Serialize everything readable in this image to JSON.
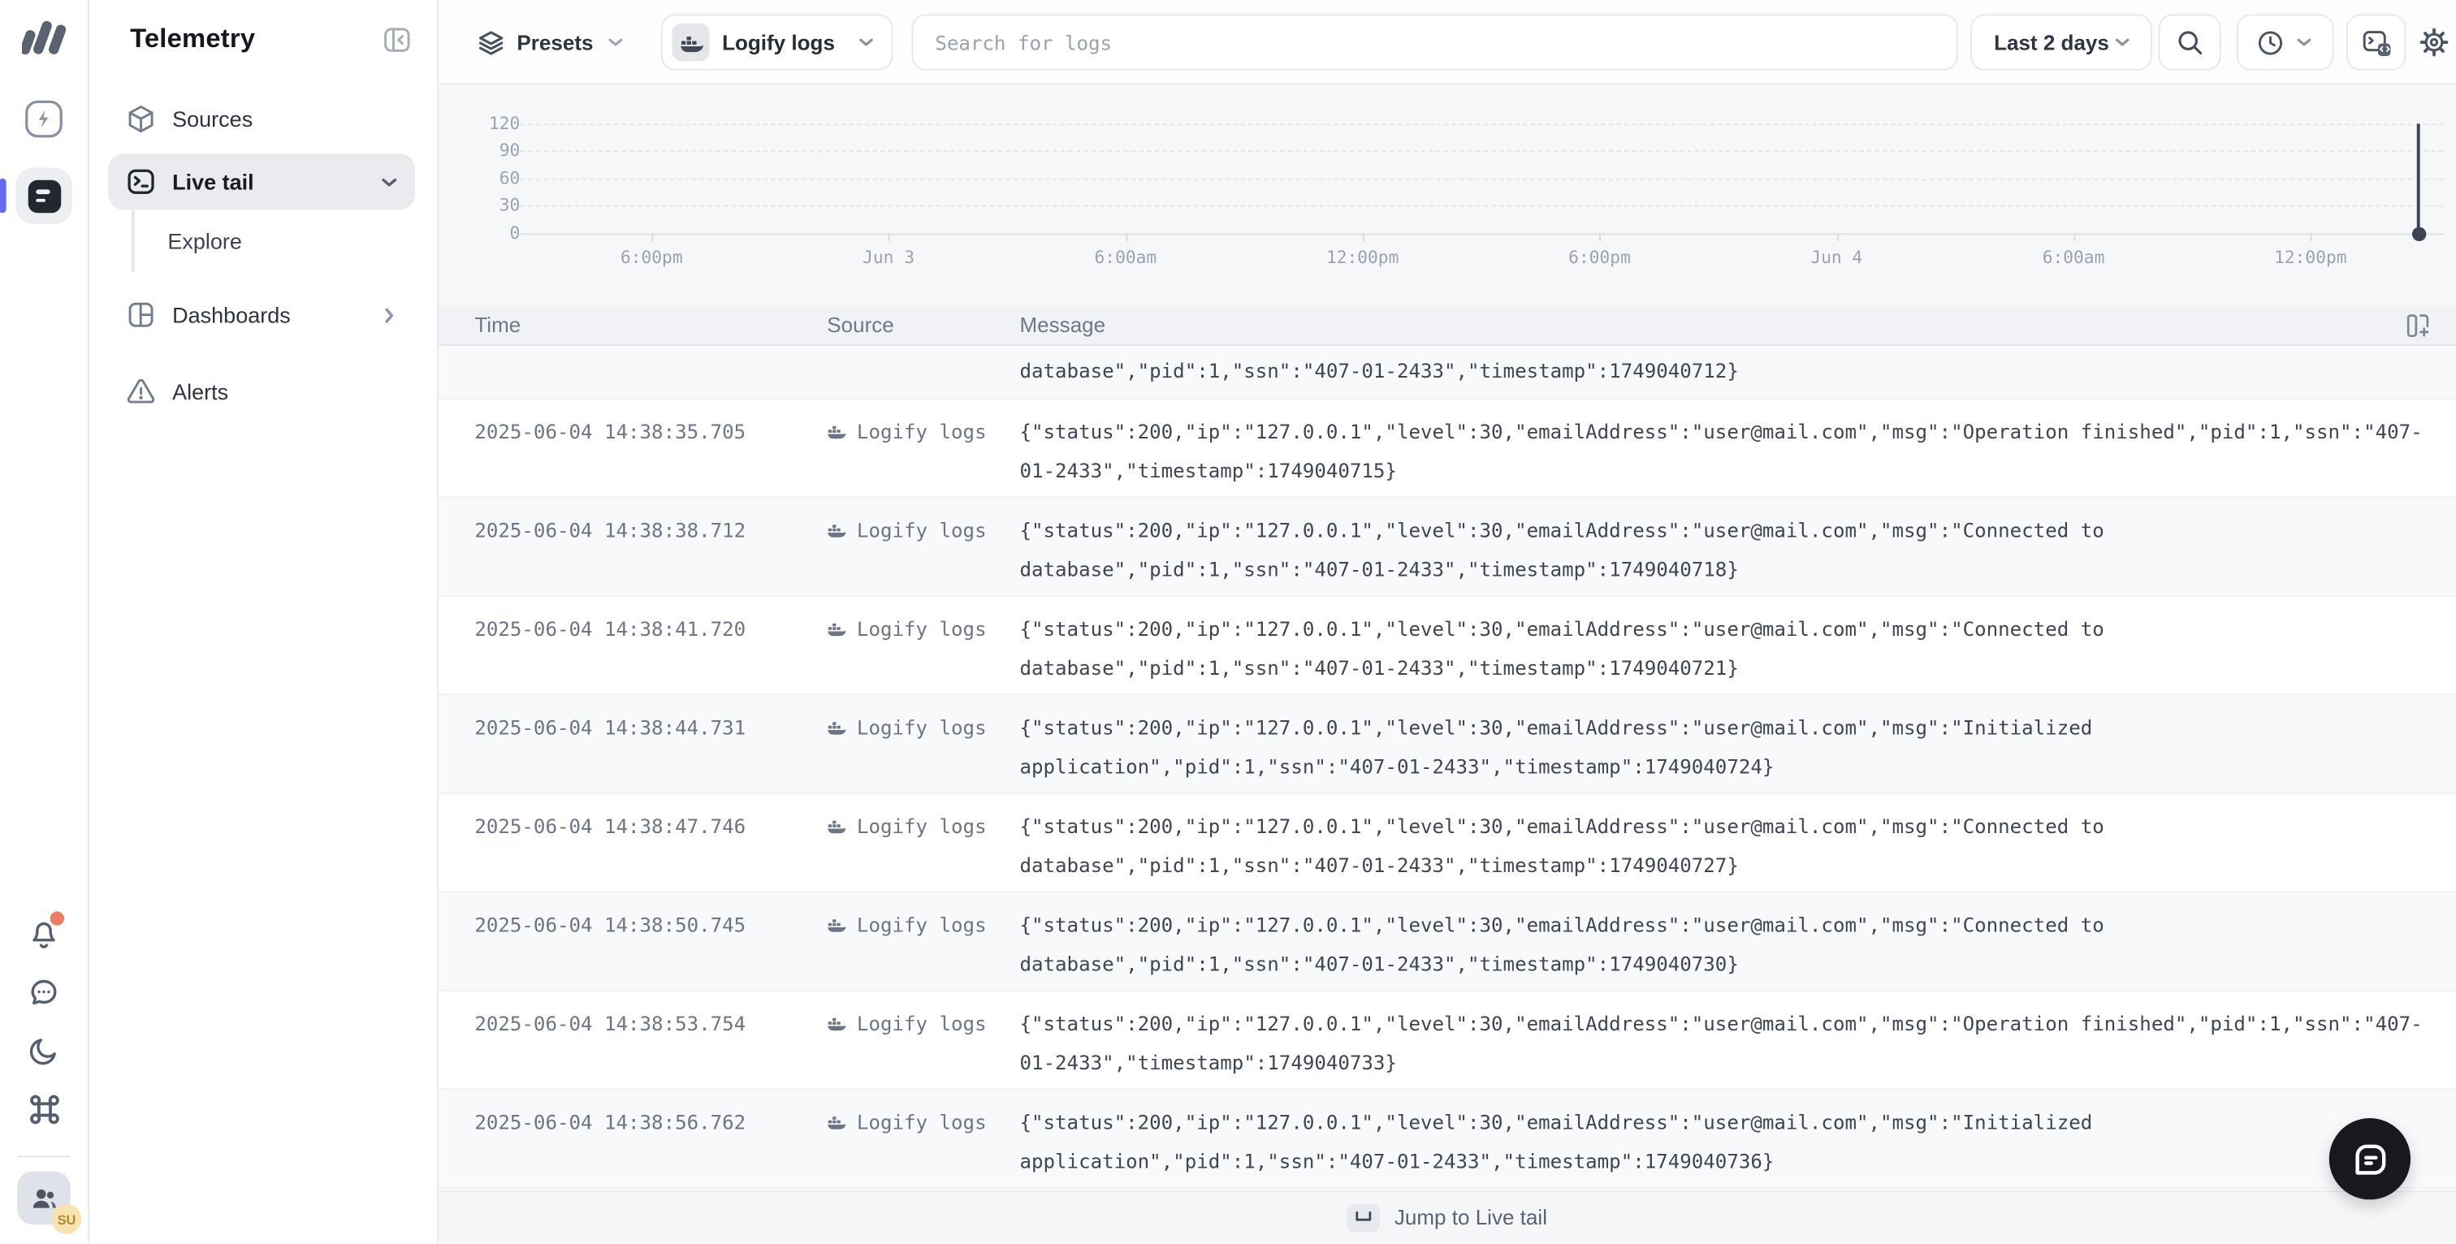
{
  "app": {
    "title": "Telemetry"
  },
  "rail": {
    "user_initials": "SU"
  },
  "sidebar": {
    "title": "Telemetry",
    "items": [
      {
        "label": "Sources"
      },
      {
        "label": "Live tail",
        "selected": true
      },
      {
        "label": "Explore",
        "child": true
      },
      {
        "label": "Dashboards"
      },
      {
        "label": "Alerts"
      }
    ]
  },
  "topbar": {
    "presets_label": "Presets",
    "source_select": "Logify logs",
    "search_placeholder": "Search for logs",
    "time_range": "Last 2 days"
  },
  "chart_data": {
    "type": "bar",
    "title": "",
    "xlabel": "",
    "ylabel": "",
    "x_ticks": [
      "6:00pm",
      "Jun 3",
      "6:00am",
      "12:00pm",
      "6:00pm",
      "Jun 4",
      "6:00am",
      "12:00pm"
    ],
    "y_ticks": [
      "120",
      "90",
      "60",
      "30",
      "0"
    ],
    "ylim": [
      0,
      120
    ],
    "grid": "horizontal-dashed",
    "legend": "none",
    "series": [
      {
        "name": "log volume",
        "values": []
      }
    ],
    "time_cursor_at_right_edge": true
  },
  "table": {
    "columns": [
      "Time",
      "Source",
      "Message"
    ],
    "partial_row": {
      "message_line": "database\",\"pid\":1,\"ssn\":\"407-01-2433\",\"timestamp\":1749040712}"
    },
    "rows": [
      {
        "time": "2025-06-04 14:38:35.705",
        "source": "Logify logs",
        "message_lines": [
          "{\"status\":200,\"ip\":\"127.0.0.1\",\"level\":30,\"emailAddress\":\"user@mail.com\",\"msg\":\"Operation finished\",\"pid\":1,\"ssn\":\"407-",
          "01-2433\",\"timestamp\":1749040715}"
        ]
      },
      {
        "time": "2025-06-04 14:38:38.712",
        "source": "Logify logs",
        "message_lines": [
          "{\"status\":200,\"ip\":\"127.0.0.1\",\"level\":30,\"emailAddress\":\"user@mail.com\",\"msg\":\"Connected to",
          "database\",\"pid\":1,\"ssn\":\"407-01-2433\",\"timestamp\":1749040718}"
        ]
      },
      {
        "time": "2025-06-04 14:38:41.720",
        "source": "Logify logs",
        "message_lines": [
          "{\"status\":200,\"ip\":\"127.0.0.1\",\"level\":30,\"emailAddress\":\"user@mail.com\",\"msg\":\"Connected to",
          "database\",\"pid\":1,\"ssn\":\"407-01-2433\",\"timestamp\":1749040721}"
        ]
      },
      {
        "time": "2025-06-04 14:38:44.731",
        "source": "Logify logs",
        "message_lines": [
          "{\"status\":200,\"ip\":\"127.0.0.1\",\"level\":30,\"emailAddress\":\"user@mail.com\",\"msg\":\"Initialized",
          "application\",\"pid\":1,\"ssn\":\"407-01-2433\",\"timestamp\":1749040724}"
        ]
      },
      {
        "time": "2025-06-04 14:38:47.746",
        "source": "Logify logs",
        "message_lines": [
          "{\"status\":200,\"ip\":\"127.0.0.1\",\"level\":30,\"emailAddress\":\"user@mail.com\",\"msg\":\"Connected to",
          "database\",\"pid\":1,\"ssn\":\"407-01-2433\",\"timestamp\":1749040727}"
        ]
      },
      {
        "time": "2025-06-04 14:38:50.745",
        "source": "Logify logs",
        "message_lines": [
          "{\"status\":200,\"ip\":\"127.0.0.1\",\"level\":30,\"emailAddress\":\"user@mail.com\",\"msg\":\"Connected to",
          "database\",\"pid\":1,\"ssn\":\"407-01-2433\",\"timestamp\":1749040730}"
        ]
      },
      {
        "time": "2025-06-04 14:38:53.754",
        "source": "Logify logs",
        "message_lines": [
          "{\"status\":200,\"ip\":\"127.0.0.1\",\"level\":30,\"emailAddress\":\"user@mail.com\",\"msg\":\"Operation finished\",\"pid\":1,\"ssn\":\"407-",
          "01-2433\",\"timestamp\":1749040733}"
        ]
      },
      {
        "time": "2025-06-04 14:38:56.762",
        "source": "Logify logs",
        "message_lines": [
          "{\"status\":200,\"ip\":\"127.0.0.1\",\"level\":30,\"emailAddress\":\"user@mail.com\",\"msg\":\"Initialized",
          "application\",\"pid\":1,\"ssn\":\"407-01-2433\",\"timestamp\":1749040736}"
        ]
      }
    ]
  },
  "footer": {
    "jump_label": "Jump to Live tail"
  },
  "colors": {
    "accent_indigo": "#666af5",
    "notification_dot": "#e87f64",
    "fab_bg": "#17191e",
    "selected_pill": "#e9ebef",
    "chart_bg": "#f6f7f9",
    "header_bg": "#f0f2f5"
  }
}
